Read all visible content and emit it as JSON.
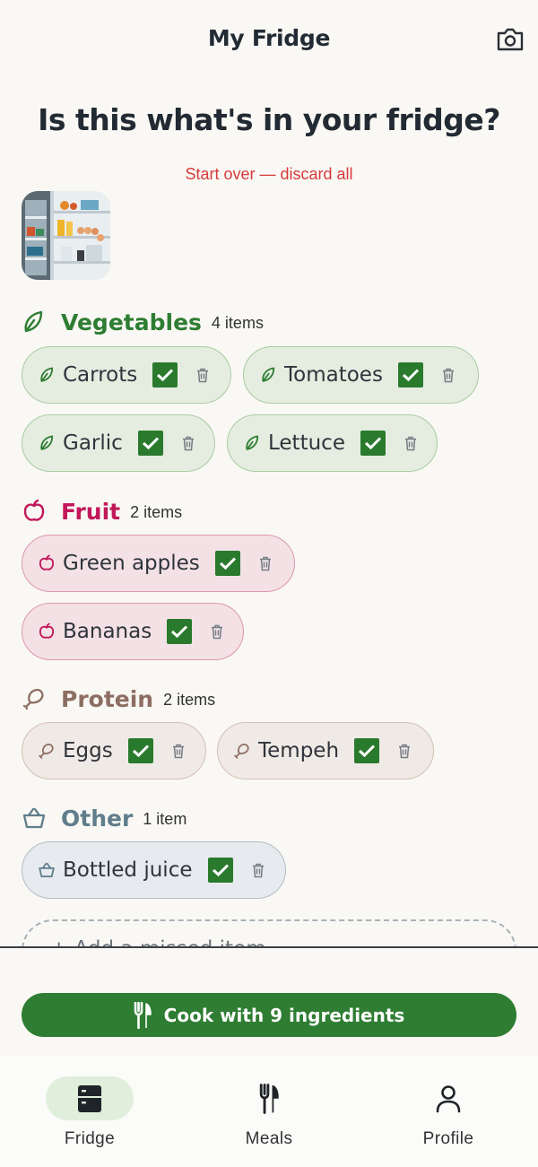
{
  "app": {
    "title": "My Fridge"
  },
  "main": {
    "question": "Is this what's in your fridge?",
    "start_over": "Start over — discard all",
    "add_missed": "+ Add a missed item"
  },
  "categories": [
    {
      "title": "Vegetables",
      "count": "4 items",
      "color": "#2e7d32",
      "icon": "leaf-icon",
      "items": [
        "Carrots",
        "Tomatoes",
        "Garlic",
        "Lettuce"
      ]
    },
    {
      "title": "Fruit",
      "count": "2 items",
      "color": "#c2185b",
      "icon": "apple-icon",
      "items": [
        "Green apples",
        "Bananas"
      ]
    },
    {
      "title": "Protein",
      "count": "2 items",
      "color": "#8d6e63",
      "icon": "drumstick-icon",
      "items": [
        "Eggs",
        "Tempeh"
      ]
    },
    {
      "title": "Other",
      "count": "1 item",
      "color": "#607d8b",
      "icon": "basket-icon",
      "items": [
        "Bottled juice"
      ]
    }
  ],
  "cook_button": {
    "label": "Cook with 9 ingredients"
  },
  "nav": [
    {
      "label": "Fridge",
      "icon": "fridge-icon",
      "active": true
    },
    {
      "label": "Meals",
      "icon": "utensils-icon",
      "active": false
    },
    {
      "label": "Profile",
      "icon": "person-icon",
      "active": false
    }
  ]
}
